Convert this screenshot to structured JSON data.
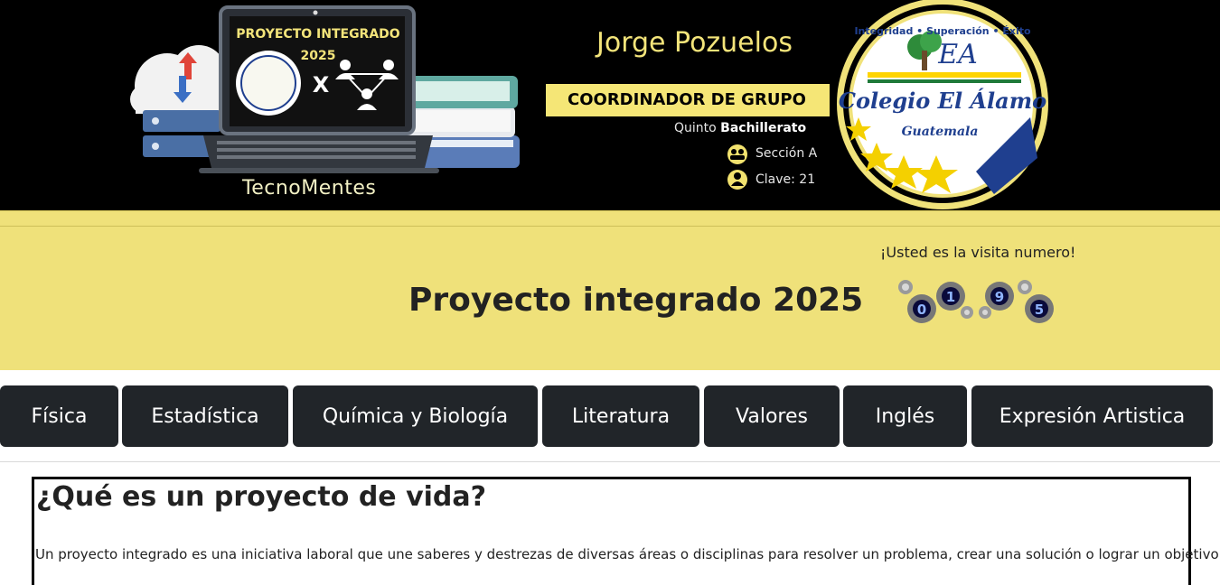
{
  "banner": {
    "laptop_title_line1": "PROYECTO INTEGRADO",
    "laptop_title_line2": "2025",
    "laptop_x": "X",
    "brand": "TecnoMentes",
    "name": "Jorge Pozuelos",
    "role": "COORDINADOR DE GRUPO",
    "grade_prefix": "Quinto",
    "grade_bold": "Bachillerato",
    "section": "Sección A",
    "clave": "Clave: 21",
    "seal_arc": "Integridad • Superación • Éxito",
    "seal_initials": "EA",
    "seal_name": "Colegio El Álamo",
    "seal_country": "Guatemala"
  },
  "header": {
    "title": "Proyecto integrado 2025",
    "visit_label": "¡Usted es la visita numero!",
    "counter_digits": [
      "0",
      "1",
      "9",
      "5"
    ]
  },
  "nav": {
    "items": [
      "Física",
      "Estadística",
      "Química y Biología",
      "Literatura",
      "Valores",
      "Inglés",
      "Expresión Artistica"
    ]
  },
  "content": {
    "heading": "¿Qué es un proyecto de vida?",
    "paragraph": "Un proyecto integrado es una iniciativa laboral que une saberes y destrezas de diversas áreas o disciplinas para resolver un problema, crear una solución o lograr un objetivo"
  },
  "colors": {
    "banner_bg": "#000000",
    "header_bg": "#efe17a",
    "nav_btn_bg": "#212529",
    "accent_yellow": "#f3e47a"
  }
}
